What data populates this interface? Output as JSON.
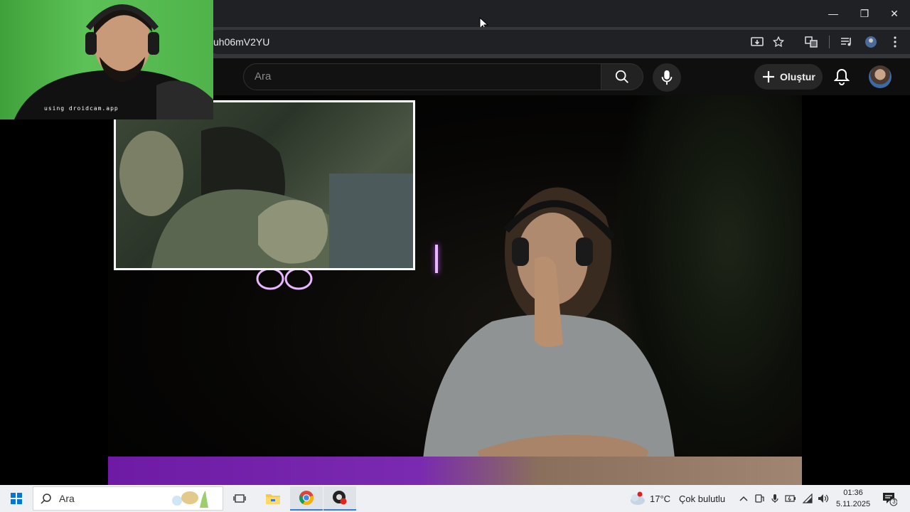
{
  "browser": {
    "url_fragment": "uh06mV2YU",
    "window_controls": {
      "minimize": "—",
      "restore": "❐",
      "close": "✕"
    }
  },
  "youtube": {
    "search_placeholder": "Ara",
    "create_label": "Oluştur"
  },
  "webcam": {
    "caption": "using droidcam.app"
  },
  "taskbar": {
    "search_placeholder": "Ara",
    "weather_temp": "17°C",
    "weather_text": "Çok bulutlu",
    "time": "01:36",
    "date": "5.11.2025",
    "notification_count": "3"
  },
  "colors": {
    "browser_bg": "#202124",
    "youtube_bg": "#0f0f0f",
    "neon": "#c050ff",
    "chroma_green": "#4fb34a",
    "taskbar_bg": "#eef0f3"
  }
}
